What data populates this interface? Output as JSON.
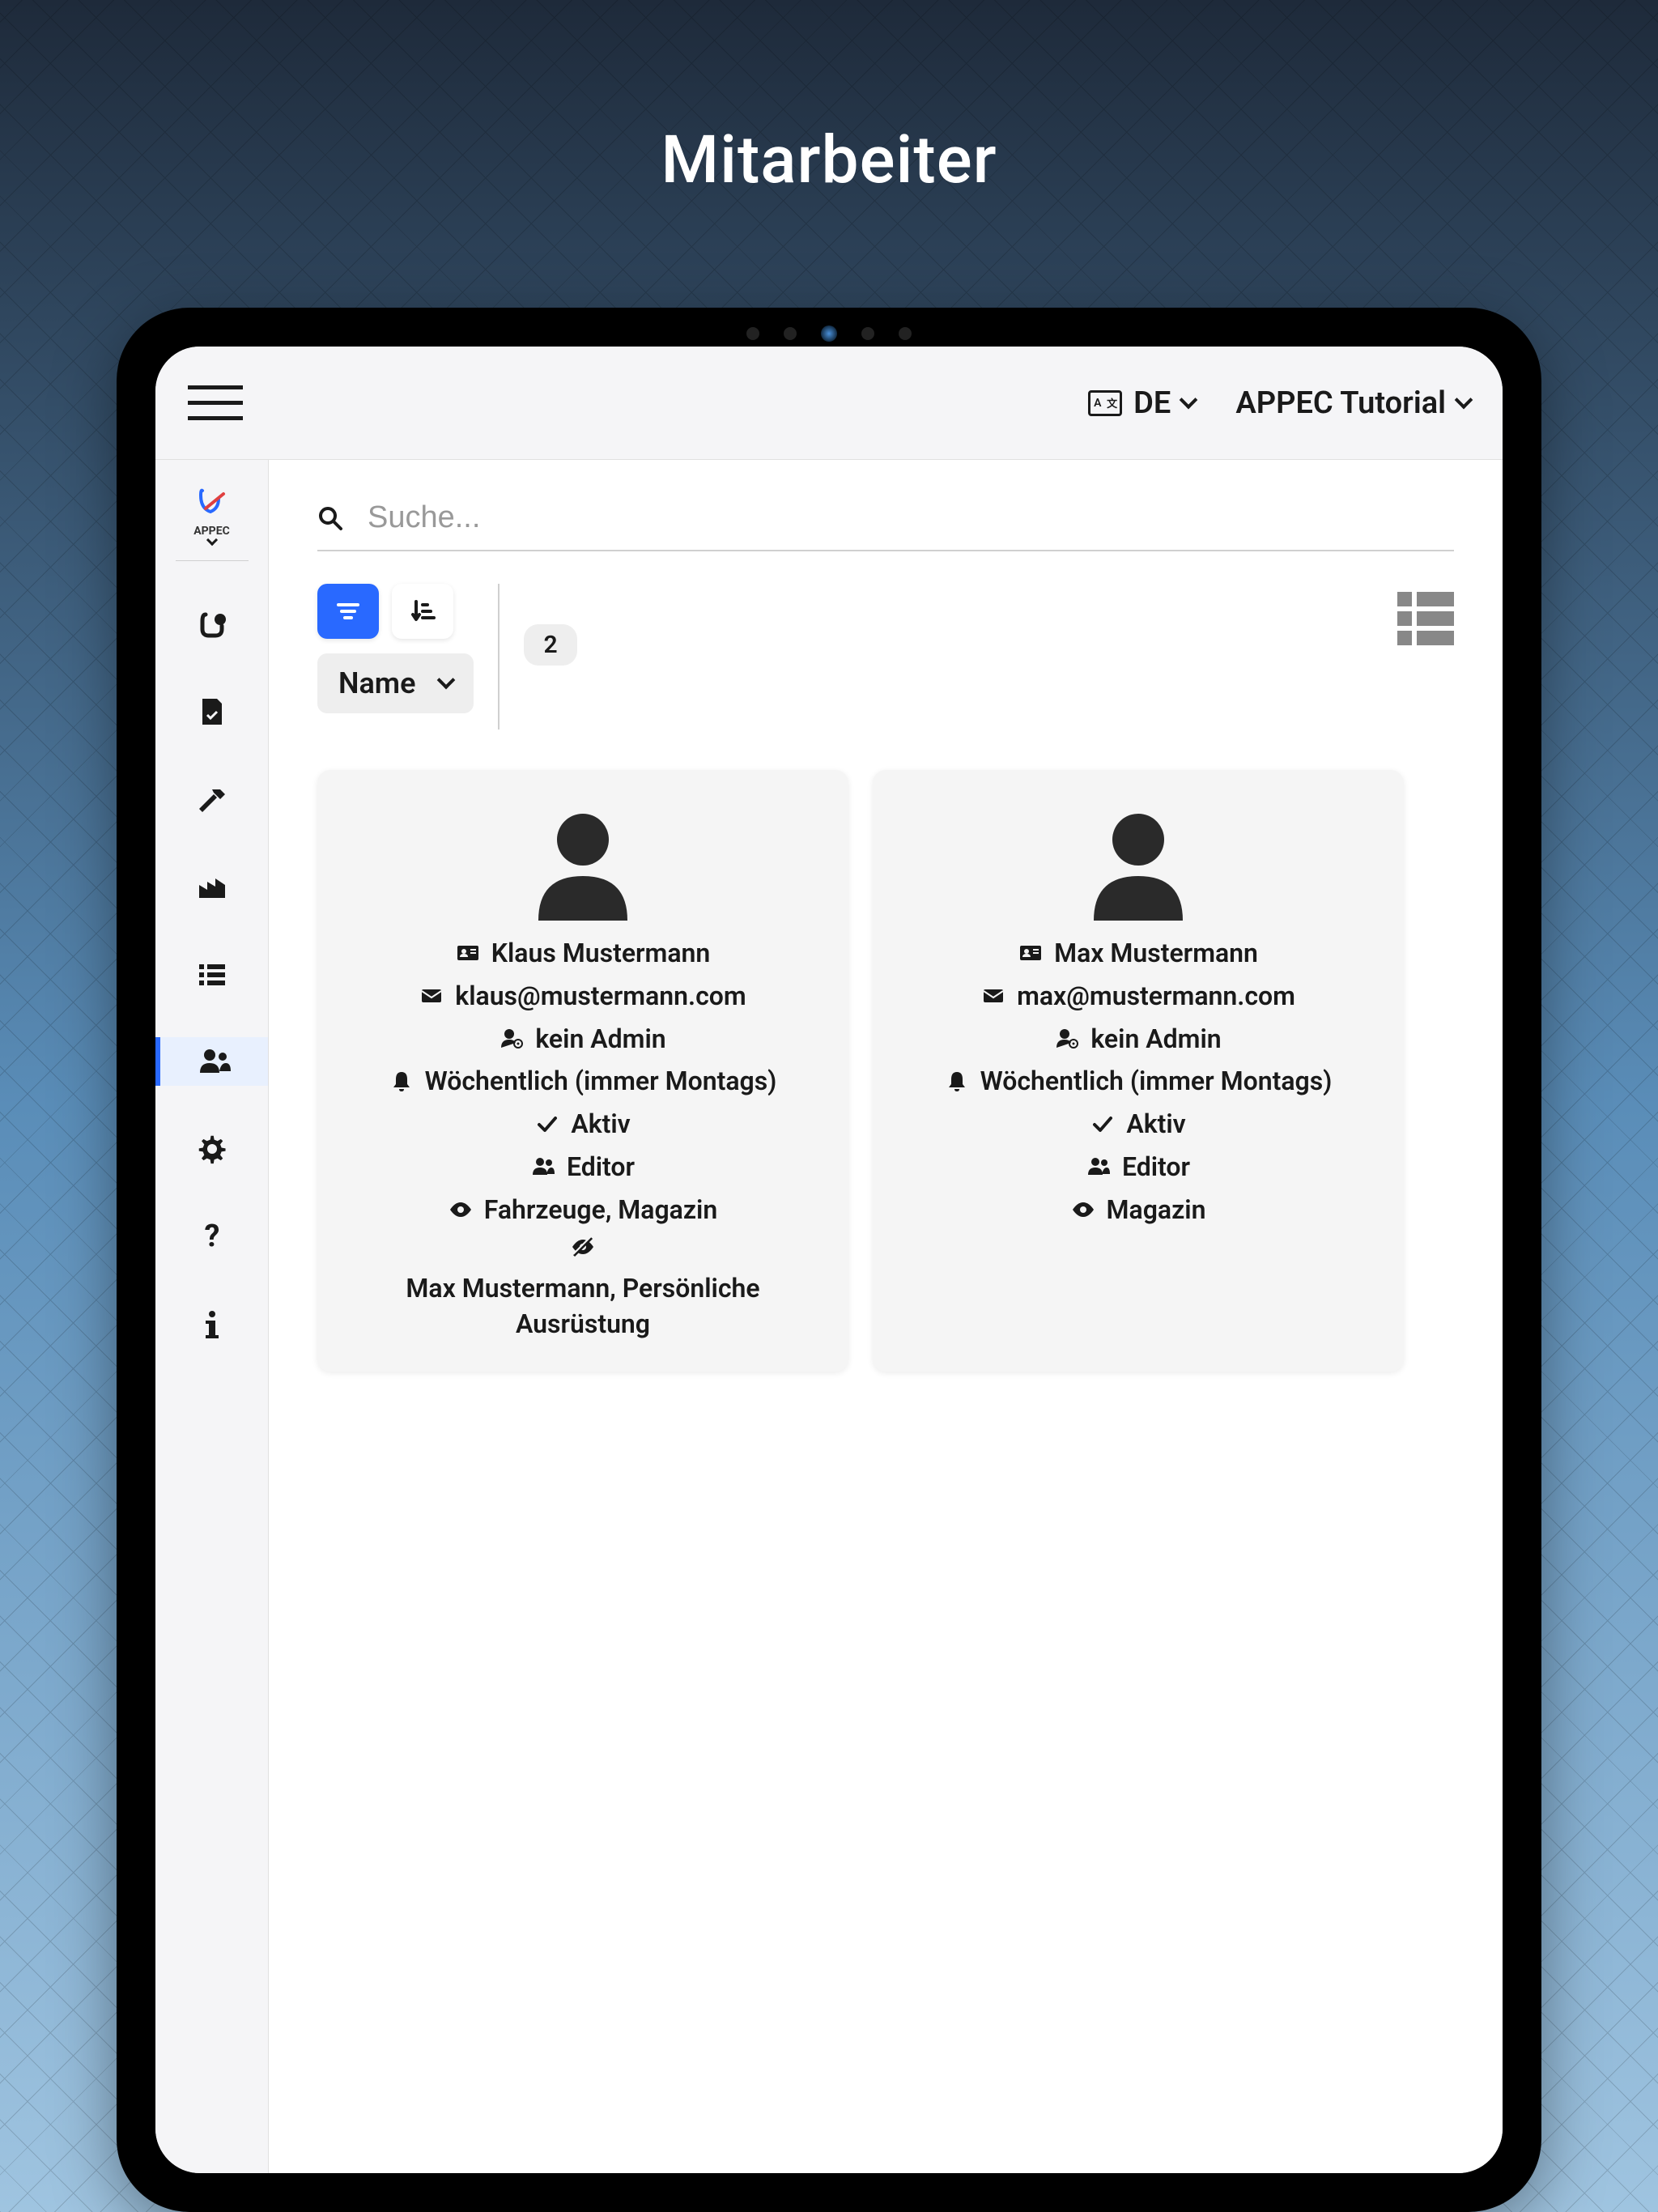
{
  "page": {
    "title": "Mitarbeiter"
  },
  "header": {
    "language": "DE",
    "project": "APPEC Tutorial"
  },
  "sidebar": {
    "logo_text": "APPEC"
  },
  "search": {
    "placeholder": "Suche..."
  },
  "filter": {
    "sort_by": "Name",
    "count": "2"
  },
  "users": [
    {
      "name": "Klaus Mustermann",
      "email": "klaus@mustermann.com",
      "admin_status": "kein Admin",
      "schedule": "Wöchentlich (immer Montags)",
      "status": "Aktiv",
      "role": "Editor",
      "visible_scope": "Fahrzeuge, Magazin",
      "hidden_scope": "Max Mustermann, Persönliche Ausrüstung"
    },
    {
      "name": "Max Mustermann",
      "email": "max@mustermann.com",
      "admin_status": "kein Admin",
      "schedule": "Wöchentlich (immer Montags)",
      "status": "Aktiv",
      "role": "Editor",
      "visible_scope": "Magazin",
      "hidden_scope": ""
    }
  ]
}
